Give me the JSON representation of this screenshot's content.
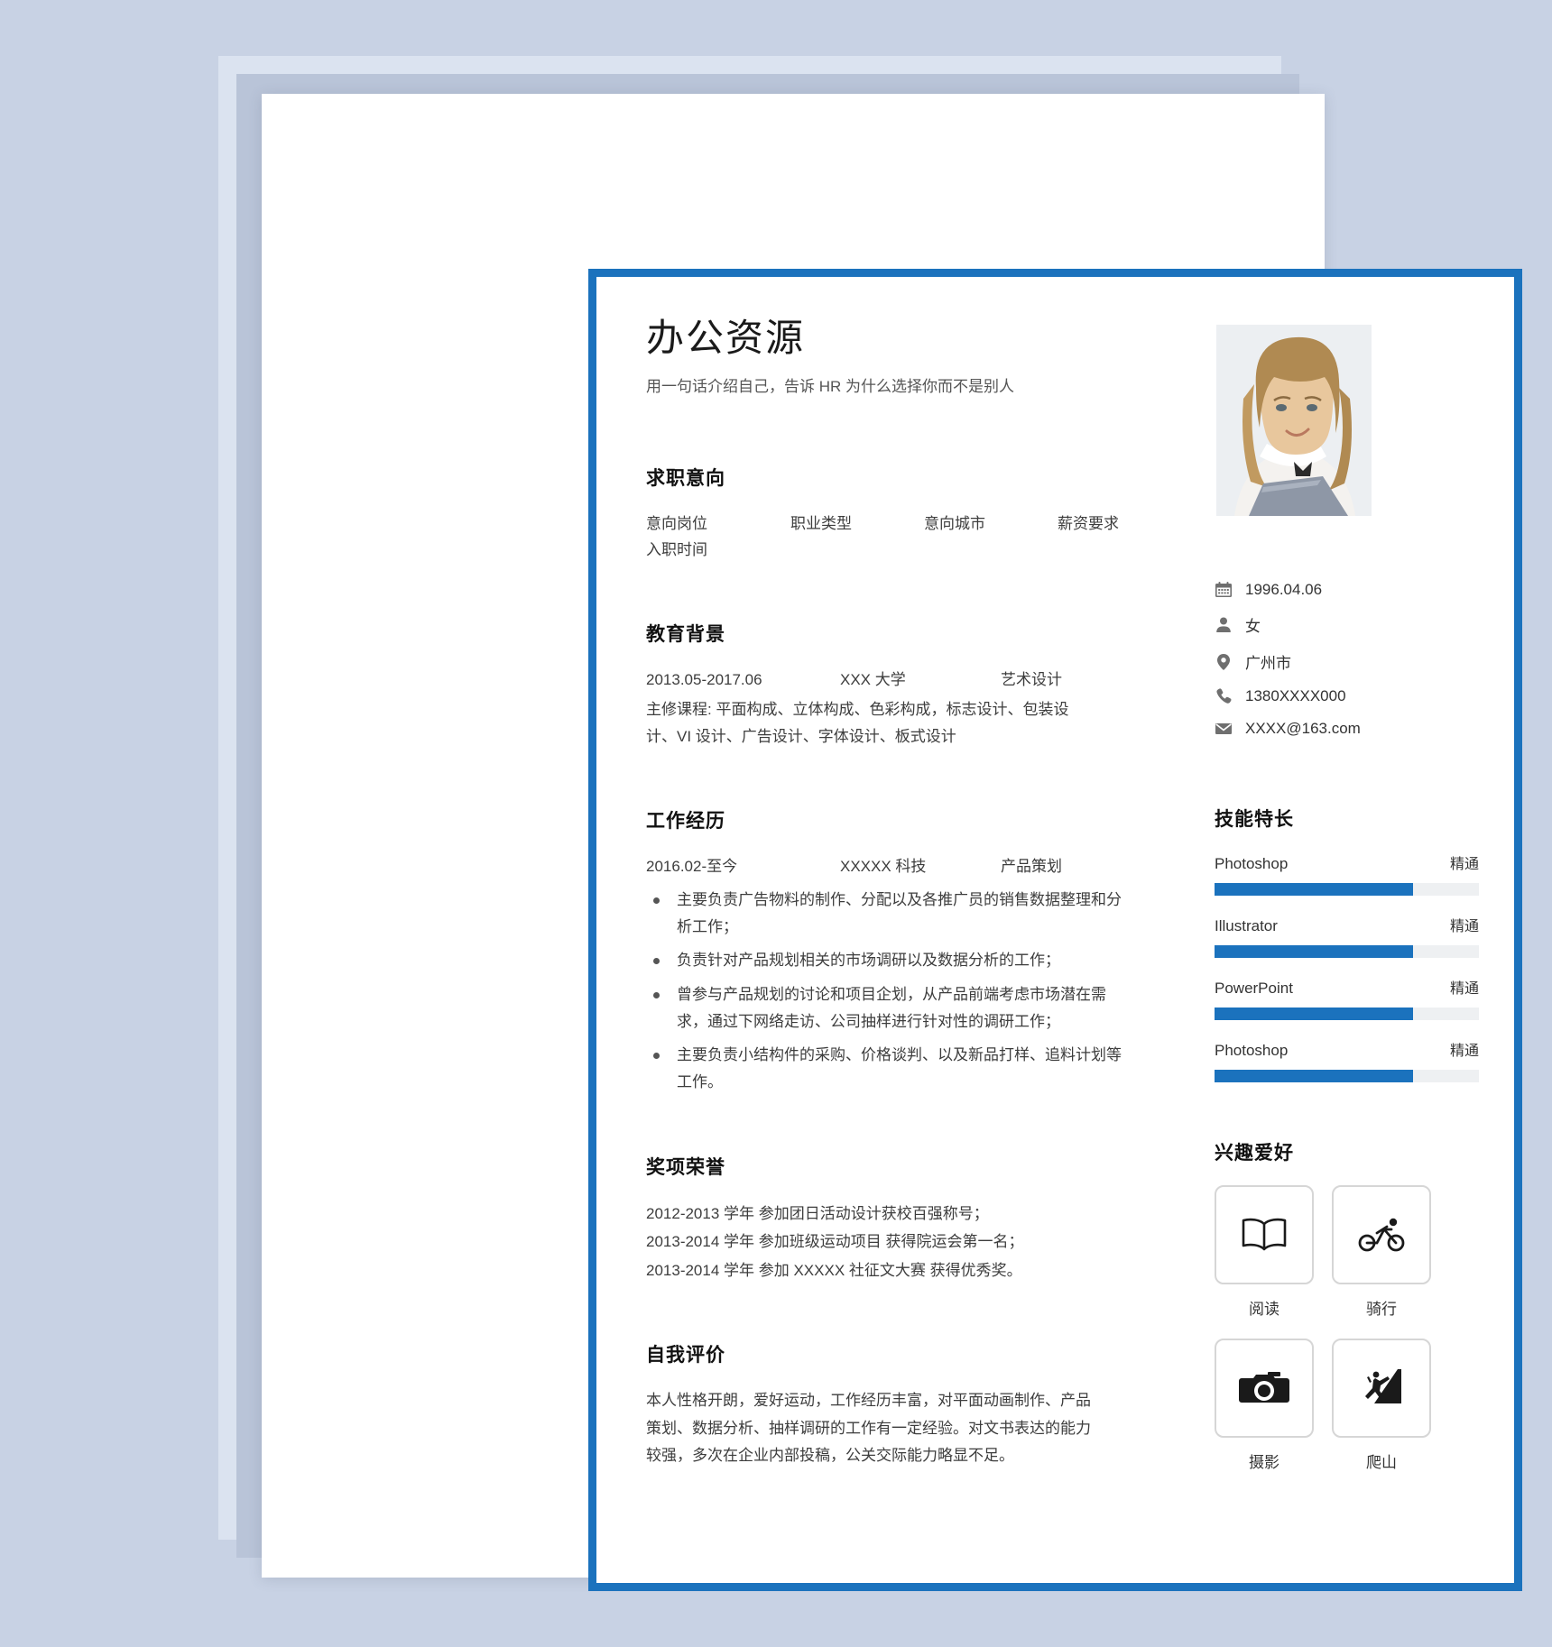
{
  "header": {
    "name": "办公资源",
    "tagline": "用一句话介绍自己，告诉 HR 为什么选择你而不是别人"
  },
  "job_intention": {
    "title": "求职意向",
    "fields": [
      "意向岗位",
      "职业类型",
      "意向城市",
      "薪资要求",
      "入职时间"
    ]
  },
  "education": {
    "title": "教育背景",
    "period": "2013.05-2017.06",
    "school": "XXX 大学",
    "major": "艺术设计",
    "courses": "主修课程: 平面构成、立体构成、色彩构成，标志设计、包装设计、VI 设计、广告设计、字体设计、板式设计"
  },
  "experience": {
    "title": "工作经历",
    "period": "2016.02-至今",
    "company": "XXXXX 科技",
    "role": "产品策划",
    "bullets": [
      "主要负责广告物料的制作、分配以及各推广员的销售数据整理和分析工作；",
      "负责针对产品规划相关的市场调研以及数据分析的工作；",
      "曾参与产品规划的讨论和项目企划，从产品前端考虑市场潜在需求，通过下网络走访、公司抽样进行针对性的调研工作；",
      "主要负责小结构件的采购、价格谈判、以及新品打样、追料计划等工作。"
    ]
  },
  "awards": {
    "title": "奖项荣誉",
    "items": [
      "2012-2013 学年  参加团日活动设计获校百强称号；",
      "2013-2014 学年  参加班级运动项目  获得院运会第一名；",
      "2013-2014 学年  参加 XXXXX 社征文大赛  获得优秀奖。"
    ]
  },
  "self_evaluation": {
    "title": "自我评价",
    "text": "本人性格开朗，爱好运动，工作经历丰富，对平面动画制作、产品策划、数据分析、抽样调研的工作有一定经验。对文书表达的能力较强，多次在企业内部投稿，公关交际能力略显不足。"
  },
  "contact": [
    {
      "icon": "calendar-icon",
      "value": "1996.04.06"
    },
    {
      "icon": "person-icon",
      "value": "女"
    },
    {
      "icon": "location-pin-icon",
      "value": "广州市"
    },
    {
      "icon": "phone-icon",
      "value": "1380XXXX000"
    },
    {
      "icon": "envelope-icon",
      "value": "XXXX@163.com"
    }
  ],
  "skills": {
    "title": "技能特长",
    "items": [
      {
        "name": "Photoshop",
        "level": "精通",
        "percent": 75
      },
      {
        "name": "Illustrator",
        "level": "精通",
        "percent": 75
      },
      {
        "name": "PowerPoint",
        "level": "精通",
        "percent": 75
      },
      {
        "name": "Photoshop",
        "level": "精通",
        "percent": 75
      }
    ]
  },
  "hobbies": {
    "title": "兴趣爱好",
    "items": [
      {
        "icon": "book-icon",
        "label": "阅读"
      },
      {
        "icon": "cyclist-icon",
        "label": "骑行"
      },
      {
        "icon": "camera-icon",
        "label": "摄影"
      },
      {
        "icon": "climbing-icon",
        "label": "爬山"
      }
    ]
  },
  "colors": {
    "accent": "#1b72bd",
    "page_background": "#c8d2e4",
    "bar_track": "#eef0f2"
  }
}
